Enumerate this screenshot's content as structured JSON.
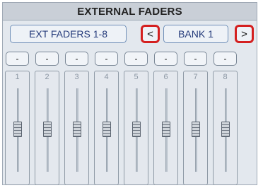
{
  "title": "EXTERNAL FADERS",
  "header": {
    "fader_range": "EXT FADERS 1-8",
    "prev_label": "<",
    "bank": "BANK 1",
    "next_label": ">"
  },
  "channels": [
    {
      "button": "-",
      "number": "1"
    },
    {
      "button": "-",
      "number": "2"
    },
    {
      "button": "-",
      "number": "3"
    },
    {
      "button": "-",
      "number": "4"
    },
    {
      "button": "-",
      "number": "5"
    },
    {
      "button": "-",
      "number": "6"
    },
    {
      "button": "-",
      "number": "7"
    },
    {
      "button": "-",
      "number": "8"
    }
  ],
  "colors": {
    "highlight": "#d42020",
    "label_text": "#243a7a"
  }
}
